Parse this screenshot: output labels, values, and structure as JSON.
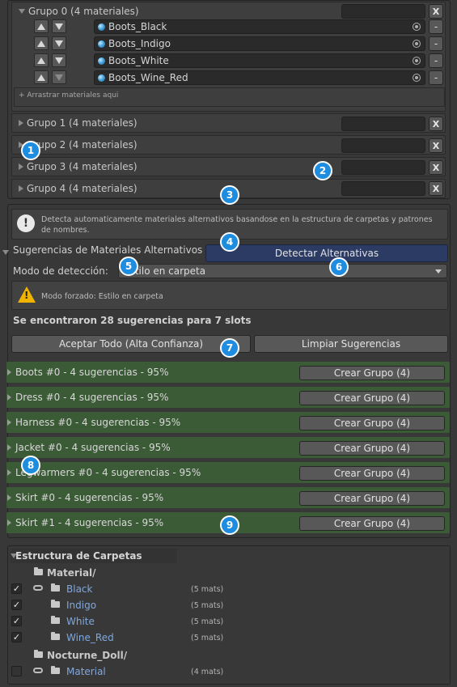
{
  "groups": [
    {
      "title": "Grupo 0 (4 materiales)"
    },
    {
      "title": "Grupo 1 (4 materiales)"
    },
    {
      "title": "Grupo 2 (4 materiales)"
    },
    {
      "title": "Grupo 3 (4 materiales)"
    },
    {
      "title": "Grupo 4 (4 materiales)"
    }
  ],
  "group0": {
    "materials": [
      "Boots_Black",
      "Boots_Indigo",
      "Boots_White",
      "Boots_Wine_Red"
    ],
    "drop_hint": "+ Arrastrar materiales aqui",
    "remove_label": "-"
  },
  "close_label": "X",
  "info": {
    "text": "Detecta automaticamente materiales alternativos basandose en la estructura de carpetas y patrones de nombres."
  },
  "suggestions": {
    "title": "Sugerencias de Materiales Alternativos",
    "detect_button": "Detectar Alternativas",
    "mode_label": "Modo de detección:",
    "mode_value": "Estilo en carpeta",
    "warning": "Modo forzado: Estilo en carpeta",
    "summary": "Se encontraron 28 sugerencias para 7 slots",
    "accept_all": "Aceptar Todo (Alta Confianza)",
    "clear": "Limpiar Sugerencias",
    "create_label": "Crear Grupo (4)",
    "rows": [
      "Boots #0 - 4 sugerencias - 95%",
      "Dress #0 - 4 sugerencias - 95%",
      "Harness #0 - 4 sugerencias - 95%",
      "Jacket #0 - 4 sugerencias - 95%",
      "Legwarmers #0 - 4 sugerencias - 95%",
      "Skirt #0 - 4 sugerencias - 95%",
      "Skirt #1 - 4 sugerencias - 95%"
    ]
  },
  "folders": {
    "title": "Estructura de Carpetas",
    "material_root": "Material/",
    "material_children": [
      {
        "name": "Black",
        "count": "(5 mats)"
      },
      {
        "name": "Indigo",
        "count": "(5 mats)"
      },
      {
        "name": "White",
        "count": "(5 mats)"
      },
      {
        "name": "Wine_Red",
        "count": "(5 mats)"
      }
    ],
    "doll_root": "Nocturne_Doll/",
    "doll_child": {
      "name": "Material",
      "count": "(4 mats)"
    }
  },
  "badges": [
    "1",
    "2",
    "3",
    "4",
    "5",
    "6",
    "7",
    "8",
    "9"
  ]
}
